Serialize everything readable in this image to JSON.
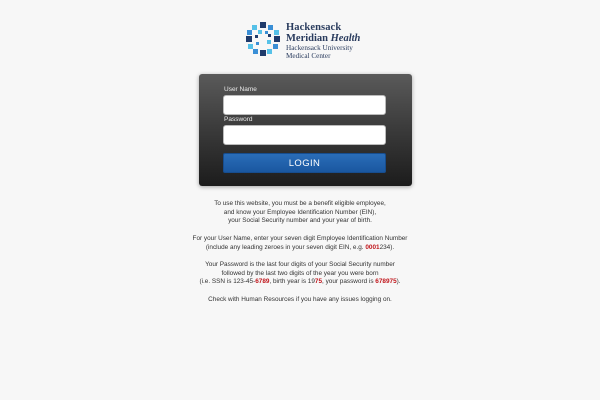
{
  "logo": {
    "line1": "Hackensack",
    "line2_regular": "Meridian",
    "line2_italic": "Health",
    "line3": "Hackensack University",
    "line4": "Medical Center",
    "colors": {
      "navy": "#1f3a6b",
      "blue": "#3a8fd6",
      "cyan": "#56c1e8"
    }
  },
  "form": {
    "username_label": "User Name",
    "username_value": "",
    "password_label": "Password",
    "password_value": "",
    "login_label": "LOGIN",
    "accent_color": "#1f5fa8"
  },
  "info": {
    "p1": [
      "To use this website, you must be a benefit eligible employee,",
      "and know your Employee Identification Number (EIN),",
      "your Social Security number and your year of birth."
    ],
    "p2": {
      "line1": "For your User Name, enter your seven digit Employee Identification Number",
      "line2_pre": "(include any leading zeroes in your seven digit EIN, e.g. ",
      "line2_red": "0001",
      "line2_post": "234)."
    },
    "p3": {
      "line1": "Your Password is the last four digits of your Social Security number",
      "line2": "followed by the last two digits of the year you were born",
      "line3_a": "(i.e. SSN is 123-45-",
      "line3_b": "6789",
      "line3_c": ", birth year is 19",
      "line3_d": "75",
      "line3_e": ", your password is ",
      "line3_f": "678975",
      "line3_g": ")."
    },
    "p4": "Check with Human Resources if you have any issues logging on."
  }
}
